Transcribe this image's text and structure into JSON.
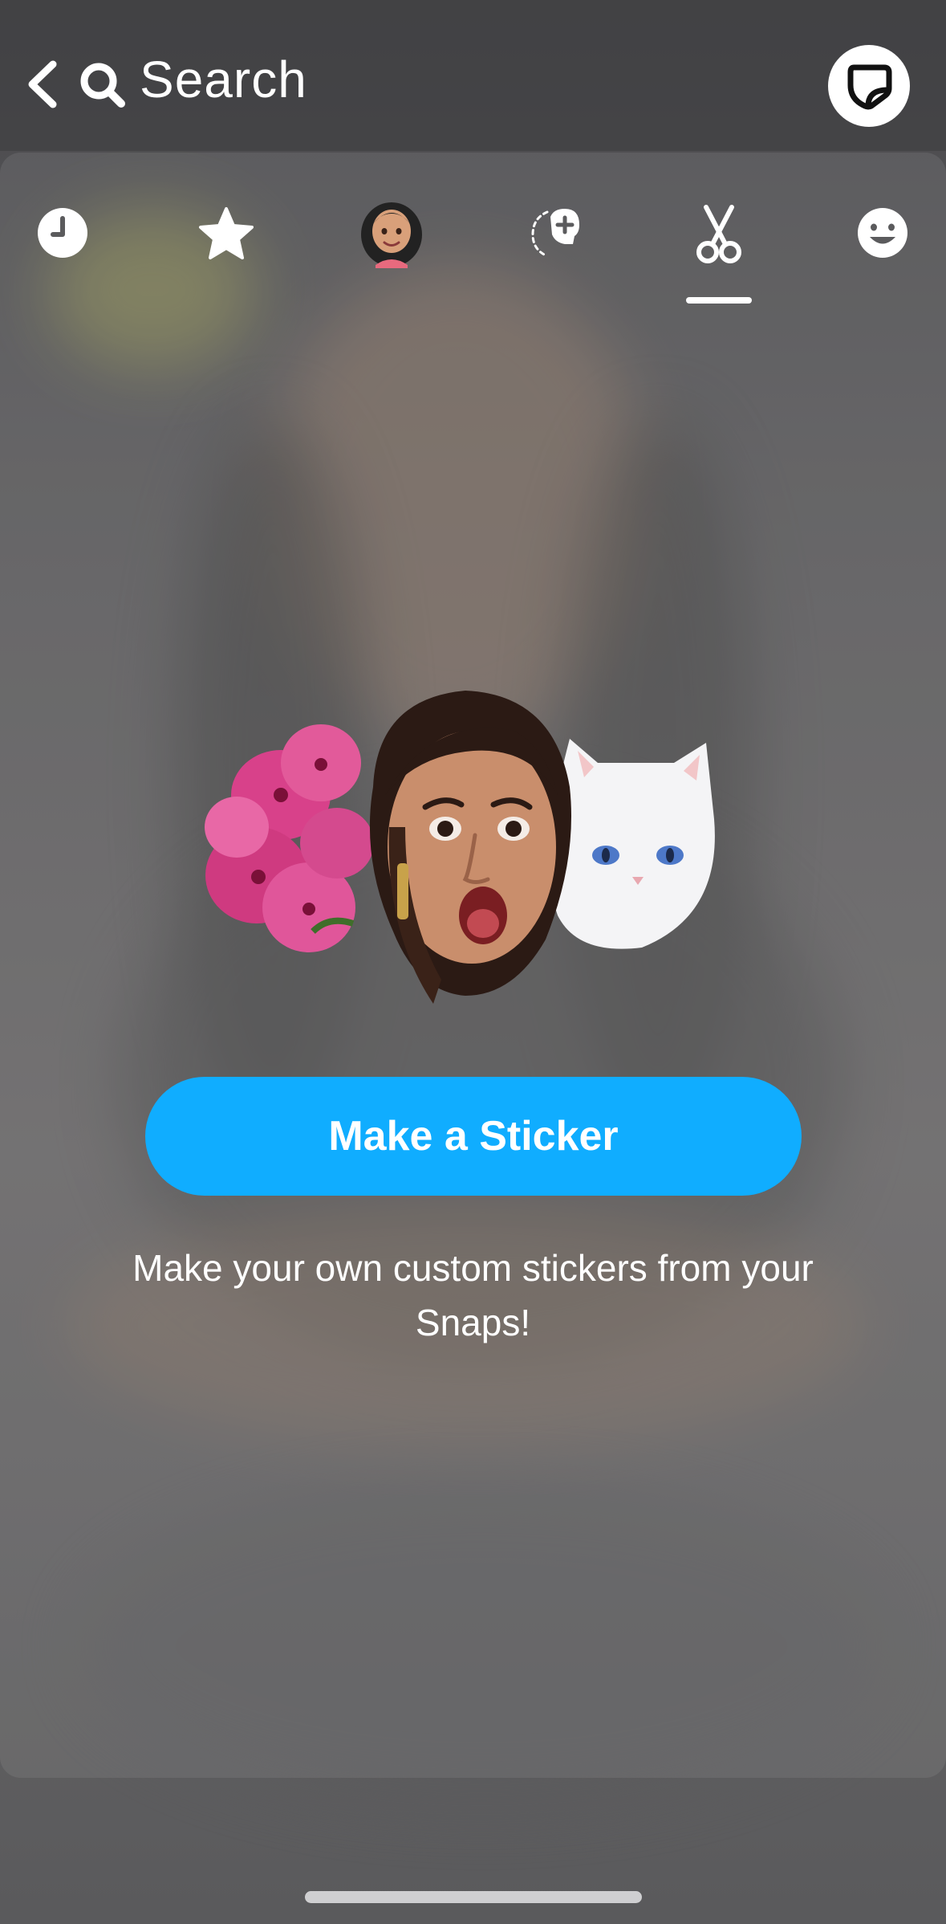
{
  "header": {
    "back_icon": "chevron-left-icon",
    "search_icon": "search-icon",
    "search_label": "Search",
    "sticker_button_icon": "sticker-icon"
  },
  "tabs": [
    {
      "id": "recents",
      "icon": "clock-icon",
      "selected": false
    },
    {
      "id": "favorites",
      "icon": "star-icon",
      "selected": false
    },
    {
      "id": "bitmoji",
      "icon": "bitmoji-avatar-icon",
      "selected": false
    },
    {
      "id": "cameos",
      "icon": "cameo-face-icon",
      "selected": false
    },
    {
      "id": "custom-stickers",
      "icon": "scissors-icon",
      "selected": true
    },
    {
      "id": "emoji",
      "icon": "smiley-icon",
      "selected": false
    }
  ],
  "main": {
    "illustration": "sticker-collage",
    "cta_label": "Make a Sticker",
    "caption": "Make your own custom stickers from your Snaps!"
  },
  "colors": {
    "accent": "#10adff",
    "background": "#333336"
  }
}
